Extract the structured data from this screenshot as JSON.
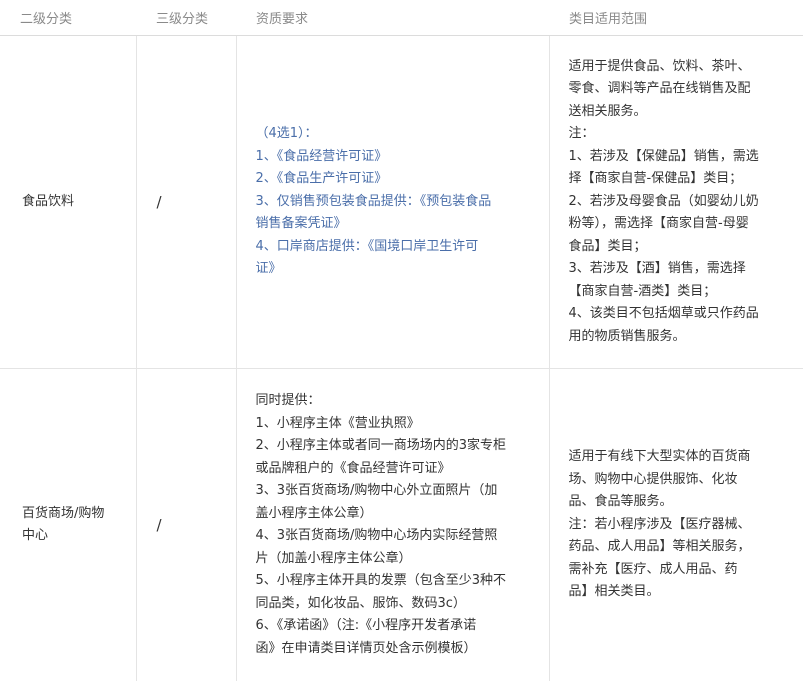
{
  "headers": {
    "level2": "二级分类",
    "level3": "三级分类",
    "qualification": "资质要求",
    "scope": "类目适用范围"
  },
  "rows": [
    {
      "level2": "食品饮料",
      "level3": "/",
      "qualification": [
        "（4选1）：",
        "1、《食品经营许可证》",
        "2、《食品生产许可证》",
        "3、仅销售预包装食品提供：《预包装食品",
        "销售备案凭证》",
        "4、口岸商店提供：《国境口岸卫生许可",
        "证》"
      ],
      "scope": [
        "适用于提供食品、饮料、茶叶、",
        "零食、调料等产品在线销售及配",
        "送相关服务。",
        "注：",
        "1、若涉及【保健品】销售，需选",
        "择【商家自营-保健品】类目；",
        "2、若涉及母婴食品（如婴幼儿奶",
        "粉等），需选择【商家自营-母婴",
        "食品】类目；",
        "3、若涉及【酒】销售，需选择",
        "【商家自营-酒类】类目；",
        "4、该类目不包括烟草或只作药品",
        "用的物质销售服务。"
      ]
    },
    {
      "level2_lines": [
        "百货商场/购物",
        "中心"
      ],
      "level3": "/",
      "qualification": [
        "同时提供：",
        "1、小程序主体《营业执照》",
        "2、小程序主体或者同一商场场内的3家专柜",
        "或品牌租户的《食品经营许可证》",
        "3、3张百货商场/购物中心外立面照片（加",
        "盖小程序主体公章）",
        "4、3张百货商场/购物中心场内实际经营照",
        "片（加盖小程序主体公章）",
        "5、小程序主体开具的发票（包含至少3种不",
        "同品类，如化妆品、服饰、数码3c）",
        "6、《承诺函》（注:《小程序开发者承诺",
        "函》在申请类目详情页处含示例模板）"
      ],
      "scope": [
        "适用于有线下大型实体的百货商",
        "场、购物中心提供服饰、化妆",
        "品、食品等服务。",
        "注：若小程序涉及【医疗器械、",
        "药品、成人用品】等相关服务，",
        "需补充【医疗、成人用品、药",
        "品】相关类目。"
      ]
    }
  ]
}
